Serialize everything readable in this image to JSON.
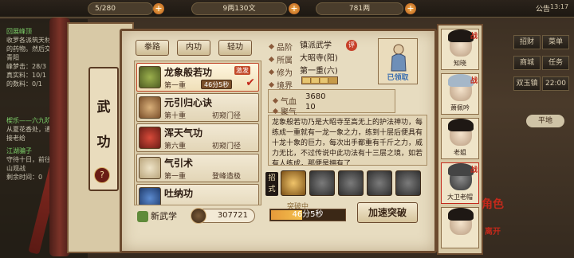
{
  "topbar": {
    "stamina": "5/280",
    "money": "9两130文",
    "gold": "781两",
    "notice": "公告",
    "time": "13:17"
  },
  "quests": [
    {
      "title": "回展峰顶",
      "lines": [
        "收罗各派筑天材",
        "的药物。然后交",
        "青阳",
        "峰梦击：28/3",
        "真实料：10/1",
        "的数料：0/1"
      ]
    },
    {
      "title": "楔乐——六九阶",
      "lines": [
        "从夏花香处，通块",
        "接老给"
      ]
    },
    {
      "title": "江湖骗子",
      "lines": [
        "守待十日，前往",
        "山观战",
        "剩余时间：0"
      ]
    }
  ],
  "scroll": {
    "title_1": "武",
    "title_2": "功",
    "help": "?"
  },
  "tabs": [
    "拳路",
    "内功",
    "轻功"
  ],
  "skills": [
    {
      "name": "龙象般若功",
      "level": "第一重",
      "tier": "",
      "badge": "激发",
      "timer": "46分5秒",
      "selected": true
    },
    {
      "name": "元引归心诀",
      "level": "第十重",
      "tier": "初窥门径",
      "badge": "",
      "timer": "",
      "selected": false
    },
    {
      "name": "浑天气功",
      "level": "第六重",
      "tier": "初窥门径",
      "badge": "",
      "timer": "",
      "selected": false
    },
    {
      "name": "气引术",
      "level": "第一重",
      "tier": "登峰造极",
      "badge": "",
      "timer": "",
      "selected": false
    },
    {
      "name": "吐纳功",
      "level": "",
      "tier": "",
      "badge": "",
      "timer": "",
      "selected": false
    }
  ],
  "footer": {
    "new_skill": "新武学",
    "potential": "307721"
  },
  "detail": {
    "grade_label": "品阶",
    "grade_value": "镇派武学",
    "grade_badge": "评",
    "sect_label": "所属",
    "sect_value": "大昭寺(阳)",
    "cultivation_label": "修为",
    "cultivation_value": "第一重(六)",
    "realm_label": "境界",
    "portrait_label": "已领取",
    "stat1_label": "气血",
    "stat1_value": "3680",
    "stat2_label": "聚气",
    "stat2_value": "10",
    "description": "龙象般若功乃是大昭寺至高无上的护法神功，每练成一重就有一龙一象之力，练到十层后便具有十龙十象的巨力，每次出手都重有千斤之力，威力无比，不过传说中此功法有十三层之境，如若有人练成，那便是拥有了",
    "moves_label": "招式",
    "break_label": "突破中",
    "break_time": "46分5秒",
    "break_progress": 0.42,
    "speedup": "加速突破"
  },
  "characters": [
    {
      "name": "知晓",
      "war": "战"
    },
    {
      "name": "萧佩吟",
      "war": "战"
    },
    {
      "name": "老姐",
      "war": ""
    },
    {
      "name": "大卫老帽",
      "war": "战"
    },
    {
      "name": "",
      "war": ""
    }
  ],
  "side_tags": {
    "role": "角色",
    "leave": "离开"
  },
  "right_menu": [
    "招财",
    "菜单",
    "商城",
    "任务",
    "双玉镇",
    "22:00"
  ],
  "location": "平地"
}
